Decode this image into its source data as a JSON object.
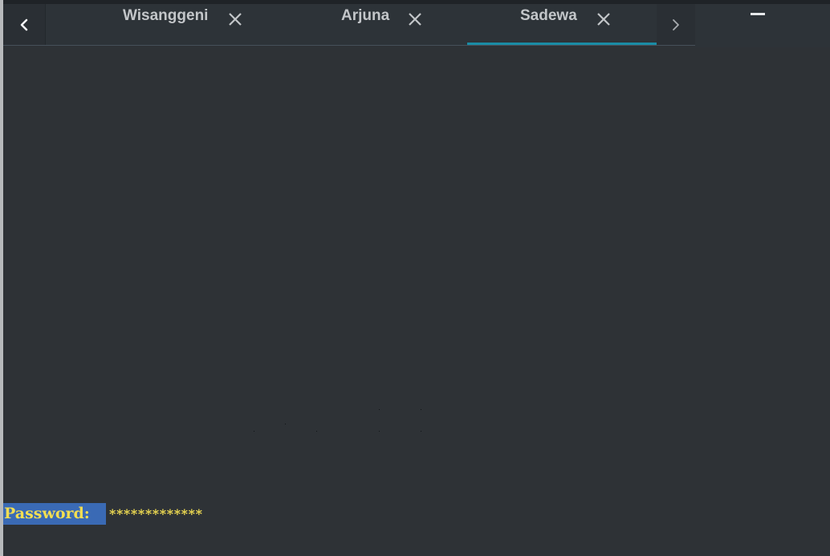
{
  "tabbar": {
    "tabs": [
      {
        "label": "Wisanggeni",
        "active": false
      },
      {
        "label": "Arjuna",
        "active": false
      },
      {
        "label": "Sadewa",
        "active": true
      }
    ]
  },
  "icons": {
    "nav_left": "chevron-left-icon",
    "nav_right": "chevron-right-icon",
    "tab_close": "close-icon",
    "minimize": "minimize-icon"
  },
  "colors": {
    "background": "#2e3236",
    "tab_text": "#c3c6c9",
    "active_tab_indicator": "#1a8ca5",
    "prompt_label_bg": "#3a6ab5",
    "prompt_text": "#f2de52"
  },
  "terminal": {
    "prompt_label": "Password:",
    "prompt_value": "*************"
  }
}
